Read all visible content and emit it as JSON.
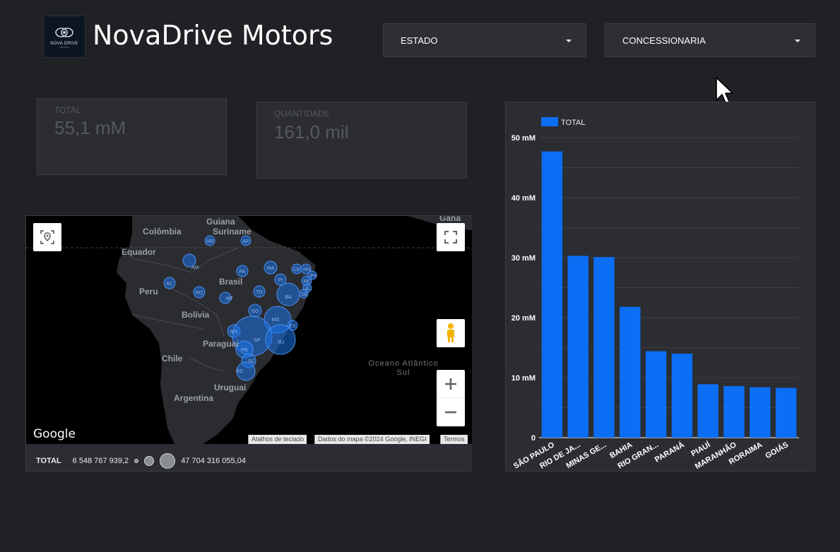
{
  "header": {
    "logo_text": "NOVA DRIVE",
    "logo_sub": "MOTORS",
    "title": "NovaDrive Motors"
  },
  "filters": {
    "estado_label": "ESTADO",
    "concessionaria_label": "CONCESSIONARIA"
  },
  "kpis": {
    "total_label": "TOTAL",
    "total_value": "55,1 mM",
    "quantidade_label": "QUANTIDADE",
    "quantidade_value": "161,0 mil"
  },
  "map": {
    "countries": [
      "Guiana",
      "Suriname",
      "Colômbia",
      "Equador",
      "Peru",
      "Brasil",
      "Bolívia",
      "Paraguai",
      "Chile",
      "Uruguai",
      "Argentina",
      "Gana"
    ],
    "ocean_label": "Oceano Atlântico Sul",
    "states": [
      "AM",
      "RR",
      "AP",
      "PA",
      "MA",
      "CE",
      "RN",
      "PB",
      "PE",
      "AL",
      "SE",
      "PI",
      "AC",
      "RO",
      "MT",
      "TO",
      "BA",
      "GO",
      "MG",
      "ES",
      "MS",
      "SP",
      "RJ",
      "PR",
      "SC",
      "RS"
    ],
    "google_label": "Google",
    "attributions": [
      "Atalhos de teclado",
      "Dados do mapa ©2024 Google, INEGI",
      "Termos"
    ],
    "legend": {
      "title": "TOTAL",
      "min_label": "6 548 767 939,2",
      "max_label": "47 704 316 055,04"
    },
    "controls": [
      "locate-icon",
      "fullscreen-icon",
      "pegman-icon",
      "zoom-in-icon",
      "zoom-out-icon"
    ]
  },
  "chart_data": {
    "type": "bar",
    "legend": [
      "TOTAL"
    ],
    "legend_position": "top-left",
    "categories": [
      "SÃO PAULO",
      "RIO DE JA...",
      "MINAS GE...",
      "BAHIA",
      "RIO GRAN...",
      "PARANÁ",
      "PIAUÍ",
      "MARANHÃO",
      "RORAIMA",
      "GOIÁS"
    ],
    "values": [
      47.7,
      30.3,
      30.1,
      21.8,
      14.4,
      14.0,
      8.9,
      8.6,
      8.4,
      8.3
    ],
    "ytick_labels": [
      "0",
      "10 mM",
      "20 mM",
      "30 mM",
      "40 mM",
      "50 mM"
    ],
    "yticks": [
      0,
      10,
      20,
      30,
      40,
      50
    ],
    "ylim": [
      0,
      50
    ],
    "grid": true,
    "color": "#0b6ef5"
  }
}
